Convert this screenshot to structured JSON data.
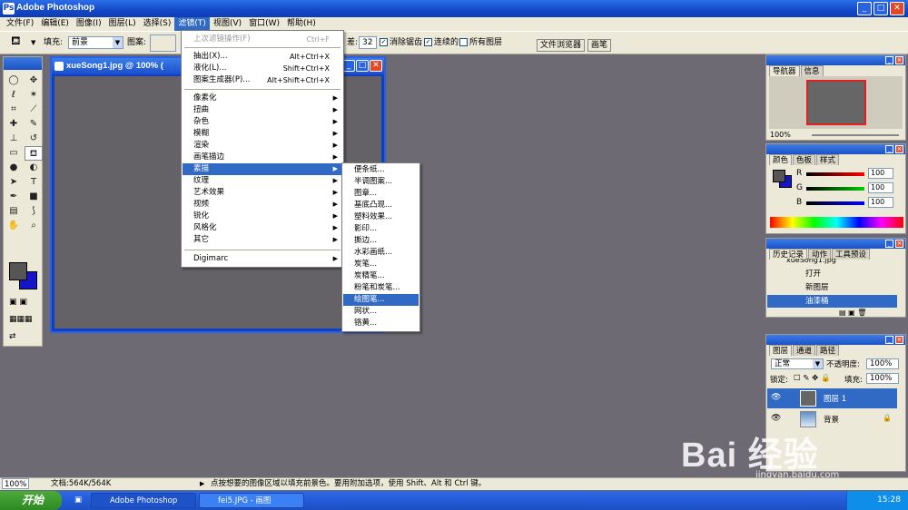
{
  "window": {
    "title": "Adobe Photoshop"
  },
  "menubar": [
    {
      "label": "文件(F)"
    },
    {
      "label": "编辑(E)"
    },
    {
      "label": "图像(I)"
    },
    {
      "label": "图层(L)"
    },
    {
      "label": "选择(S)"
    },
    {
      "label": "滤镜(T)"
    },
    {
      "label": "视图(V)"
    },
    {
      "label": "窗口(W)"
    },
    {
      "label": "帮助(H)"
    }
  ],
  "options": {
    "fill_label": "填充:",
    "fill_value": "前景",
    "pattern_label": "图案:",
    "tolerance_label": "差:",
    "tolerance_value": "32",
    "antialias_label": "消除锯齿",
    "contiguous_label": "连续的",
    "all_layers_label": "所有图层",
    "file_browser_tab": "文件浏览器",
    "brushes_tab": "画笔"
  },
  "document": {
    "title": "xueSong1.jpg @ 100% ("
  },
  "filter_menu": {
    "last": {
      "label": "上次滤镜操作(F)",
      "shortcut": "Ctrl+F"
    },
    "extract": {
      "label": "抽出(X)...",
      "shortcut": "Alt+Ctrl+X"
    },
    "liquify": {
      "label": "液化(L)...",
      "shortcut": "Shift+Ctrl+X"
    },
    "pattern": {
      "label": "图案生成器(P)...",
      "shortcut": "Alt+Shift+Ctrl+X"
    },
    "groups": [
      "像素化",
      "扭曲",
      "杂色",
      "模糊",
      "渲染",
      "画笔描边",
      "素描",
      "纹理",
      "艺术效果",
      "视频",
      "锐化",
      "风格化",
      "其它"
    ],
    "digimarc": "Digimarc"
  },
  "sketch_submenu": [
    "便条纸...",
    "半调图案...",
    "图章...",
    "基底凸现...",
    "塑料效果...",
    "影印...",
    "撕边...",
    "水彩画纸...",
    "炭笔...",
    "炭精笔...",
    "粉笔和炭笔...",
    "绘图笔...",
    "网状...",
    "铬黄..."
  ],
  "navigator": {
    "tabs": [
      "导航器",
      "信息"
    ],
    "zoom": "100%"
  },
  "color": {
    "tabs": [
      "颜色",
      "色板",
      "样式"
    ],
    "r_label": "R",
    "g_label": "G",
    "b_label": "B",
    "r": "100",
    "g": "100",
    "b": "100",
    "fg_color": "#555555",
    "bg_color": "#1515c8"
  },
  "history": {
    "tabs": [
      "历史记录",
      "动作",
      "工具预设"
    ],
    "snapshot": "xueSong1.jpg",
    "items": [
      "打开",
      "新图层",
      "油漆桶"
    ]
  },
  "layers": {
    "tabs": [
      "图层",
      "通道",
      "路径"
    ],
    "mode": "正常",
    "opacity_label": "不透明度:",
    "opacity": "100%",
    "lock_label": "锁定:",
    "fill_label": "填充:",
    "fill": "100%",
    "items": [
      "图层 1",
      "背景"
    ]
  },
  "status": {
    "zoom": "100%",
    "doc": "文档:564K/564K",
    "hint": "点按想要的图像区域以填充前景色。要用附加选项，使用 Shift、Alt 和 Ctrl 键。"
  },
  "taskbar": {
    "start": "开始",
    "items": [
      "Adobe Photoshop",
      "fei5.JPG - 画图"
    ],
    "clock": "15:28"
  },
  "watermark": {
    "logo": "Bai 经验",
    "url": "jingyan.baidu.com"
  }
}
